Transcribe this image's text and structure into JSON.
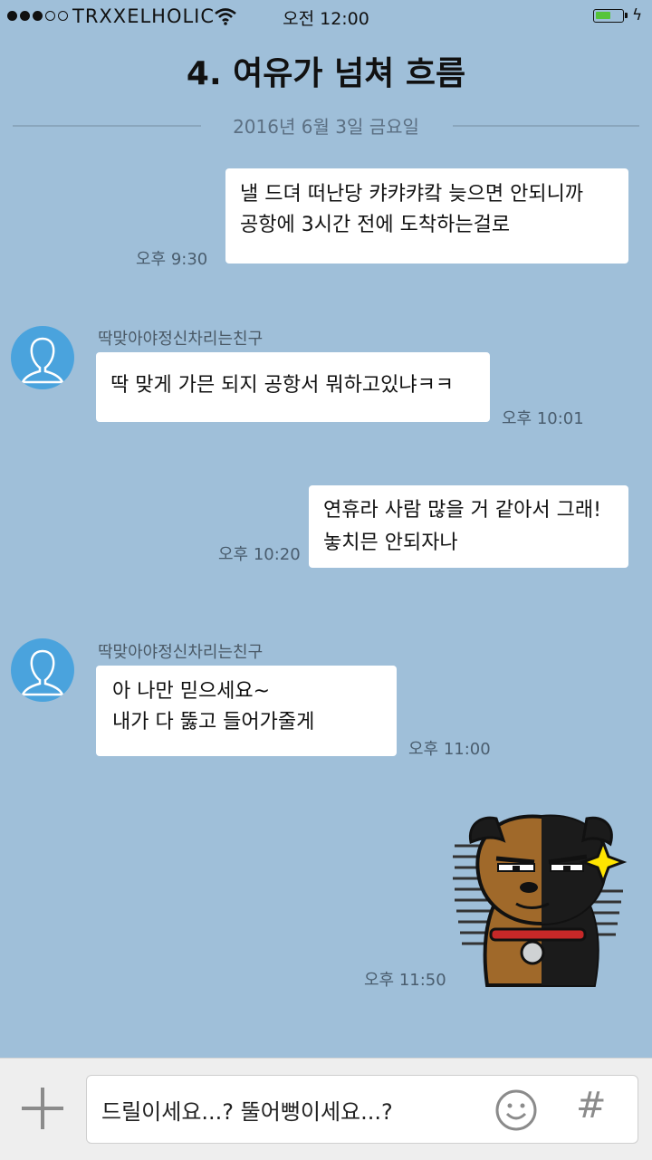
{
  "status": {
    "carrier": "TRXXELHOLIC",
    "time": "오전 12:00",
    "battery_level": 0.6,
    "battery_color": "#56c43a"
  },
  "header": {
    "title": "4. 여유가 넘쳐 흐름",
    "date": "2016년 6월 3일 금요일"
  },
  "messages": [
    {
      "side": "right",
      "lines": [
        "낼 드뎌 떠난당 캬캬캬캌 늦으면 안되니까",
        "공항에 3시간 전에 도착하는걸로"
      ],
      "time": "오후 9:30"
    },
    {
      "side": "left",
      "sender": "딱맞아야정신차리는친구",
      "lines": [
        "딱 맞게 가믄 되지 공항서 뭐하고있냐ㅋㅋ"
      ],
      "time": "오후 10:01"
    },
    {
      "side": "right",
      "lines": [
        "연휴라 사람 많을 거 같아서 그래!",
        "놓치믄 안되자나"
      ],
      "time": "오후 10:20"
    },
    {
      "side": "left",
      "sender": "딱맞아야정신차리는친구",
      "lines": [
        "아 나만 믿으세요~",
        "내가 다 뚫고 들어가줄게"
      ],
      "time": "오후 11:00"
    },
    {
      "side": "right",
      "sticker": "dog-sticker",
      "time": "오후 11:50"
    }
  ],
  "input": {
    "text": "드릴이세요...? 뚤어뻥이세요...?",
    "hash_label": "#"
  },
  "colors": {
    "background": "#9fbfd9",
    "bubble": "#ffffff",
    "avatar": "#4aa3dd"
  }
}
